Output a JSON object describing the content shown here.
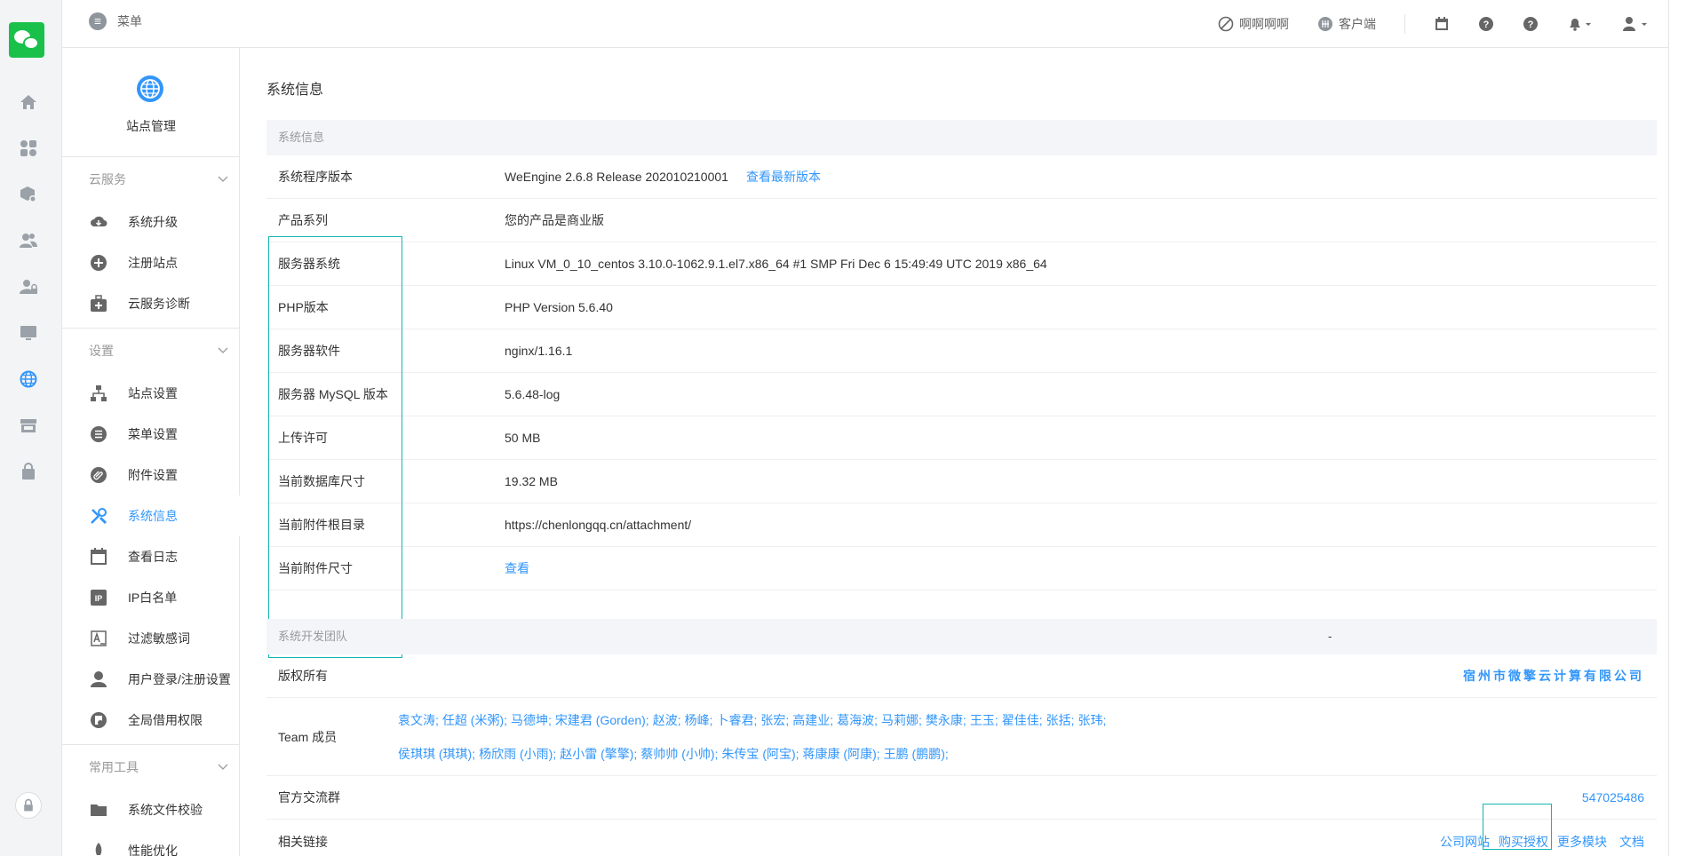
{
  "topbar": {
    "menu_label": "菜单",
    "link1": "啊啊啊啊",
    "link2": "客户端"
  },
  "sidebar": {
    "site_title": "站点管理",
    "groups": [
      {
        "title": "云服务",
        "items": [
          {
            "label": "系统升级",
            "icon": "cloud-download-icon"
          },
          {
            "label": "注册站点",
            "icon": "plus-circle-icon"
          },
          {
            "label": "云服务诊断",
            "icon": "medical-kit-icon"
          }
        ]
      },
      {
        "title": "设置",
        "items": [
          {
            "label": "站点设置",
            "icon": "sitemap-icon"
          },
          {
            "label": "菜单设置",
            "icon": "list-icon"
          },
          {
            "label": "附件设置",
            "icon": "paperclip-icon"
          },
          {
            "label": "系统信息",
            "icon": "tools-icon",
            "active": true
          },
          {
            "label": "查看日志",
            "icon": "calendar-icon"
          },
          {
            "label": "IP白名单",
            "icon": "ip-icon"
          },
          {
            "label": "过滤敏感词",
            "icon": "filter-text-icon"
          },
          {
            "label": "用户登录/注册设置",
            "icon": "user-icon"
          },
          {
            "label": "全局借用权限",
            "icon": "lock-doc-icon"
          }
        ]
      },
      {
        "title": "常用工具",
        "items": [
          {
            "label": "系统文件校验",
            "icon": "folder-icon"
          },
          {
            "label": "性能优化",
            "icon": "rocket-icon"
          }
        ]
      }
    ]
  },
  "main": {
    "page_title": "系统信息",
    "sysinfo": {
      "head": "系统信息",
      "rows": [
        {
          "k": "系统程序版本",
          "v": "WeEngine 2.6.8 Release 202010210001",
          "link": "查看最新版本"
        },
        {
          "k": "产品系列",
          "v": "您的产品是商业版"
        },
        {
          "k": "服务器系统",
          "v": "Linux VM_0_10_centos 3.10.0-1062.9.1.el7.x86_64 #1 SMP Fri Dec 6 15:49:49 UTC 2019 x86_64"
        },
        {
          "k": "PHP版本",
          "v": "PHP Version 5.6.40"
        },
        {
          "k": "服务器软件",
          "v": "nginx/1.16.1"
        },
        {
          "k": "服务器 MySQL 版本",
          "v": "5.6.48-log"
        },
        {
          "k": "上传许可",
          "v": "50 MB"
        },
        {
          "k": "当前数据库尺寸",
          "v": "19.32 MB"
        },
        {
          "k": "当前附件根目录",
          "v": "https://chenlongqq.cn/attachment/"
        },
        {
          "k": "当前附件尺寸",
          "v": "",
          "link": "查看"
        }
      ]
    },
    "team": {
      "head": "系统开发团队",
      "head_mark": "-",
      "copyright_label": "版权所有",
      "copyright_value": "宿州市微擎云计算有限公司",
      "members_label": "Team 成员",
      "members_line1": [
        "袁文涛;",
        "任超 (米粥);",
        "马德坤;",
        "宋建君 (Gorden);",
        "赵波;",
        "杨峰;",
        "卜睿君;",
        "张宏;",
        "高建业;",
        "葛海波;",
        "马莉娜;",
        "樊永康;",
        "王玉;",
        "翟佳佳;",
        "张括;",
        "张玮;"
      ],
      "members_line2": [
        "侯琪琪 (琪琪);",
        "杨欣雨 (小雨);",
        "赵小雷 (擎擎);",
        "蔡帅帅 (小帅);",
        "朱传宝 (阿宝);",
        "蒋康康 (阿康);",
        "王鹏 (鹏鹏);"
      ],
      "group_label": "官方交流群",
      "group_value": "547025486",
      "links_label": "相关链接",
      "links": [
        "公司网站",
        "购买授权",
        "更多模块",
        "文档"
      ]
    }
  }
}
